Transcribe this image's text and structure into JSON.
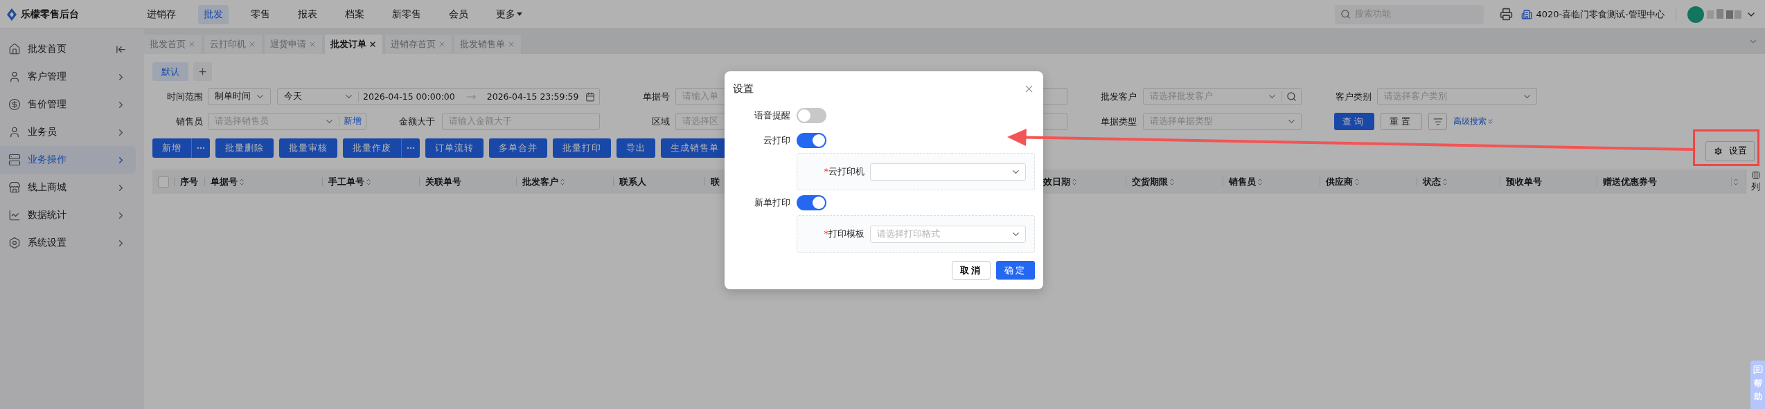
{
  "app": {
    "title": "乐檬零售后台"
  },
  "top_nav": [
    {
      "label": "进销存",
      "selected": false,
      "dropdown": false
    },
    {
      "label": "批发",
      "selected": true,
      "dropdown": false
    },
    {
      "label": "零售",
      "selected": false,
      "dropdown": false
    },
    {
      "label": "报表",
      "selected": false,
      "dropdown": false
    },
    {
      "label": "档案",
      "selected": false,
      "dropdown": false
    },
    {
      "label": "新零售",
      "selected": false,
      "dropdown": false
    },
    {
      "label": "会员",
      "selected": false,
      "dropdown": false
    },
    {
      "label": "更多",
      "selected": false,
      "dropdown": true
    }
  ],
  "header": {
    "search_placeholder": "搜索功能",
    "org": "4020-喜临门零食测试-管理中心"
  },
  "sidebar": [
    {
      "label": "批发首页",
      "selected": false
    },
    {
      "label": "客户管理",
      "selected": false
    },
    {
      "label": "售价管理",
      "selected": false
    },
    {
      "label": "业务员",
      "selected": false
    },
    {
      "label": "业务操作",
      "selected": true
    },
    {
      "label": "线上商城",
      "selected": false
    },
    {
      "label": "数据统计",
      "selected": false
    },
    {
      "label": "系统设置",
      "selected": false
    }
  ],
  "tabs": [
    {
      "label": "批发首页",
      "selected": false
    },
    {
      "label": "云打印机",
      "selected": false
    },
    {
      "label": "退货申请",
      "selected": false
    },
    {
      "label": "批发订单",
      "selected": true
    },
    {
      "label": "进销存首页",
      "selected": false
    },
    {
      "label": "批发销售单",
      "selected": false
    }
  ],
  "views": [
    {
      "label": "默认",
      "selected": true
    }
  ],
  "filters": {
    "time_range": {
      "label": "时间范围",
      "basis": "制单时间",
      "preset": "今天",
      "start": "2026-04-15 00:00:00",
      "end": "2026-04-15 23:59:59"
    },
    "doc_no": {
      "label": "单据号",
      "placeholder": "请输入单"
    },
    "customer": {
      "label": "批发客户",
      "placeholder": "请选择批发客户"
    },
    "customer_type": {
      "label": "客户类别",
      "placeholder": "请选择客户类别"
    },
    "salesperson": {
      "label": "销售员",
      "placeholder": "请选择销售员",
      "add_link": "新增"
    },
    "amount": {
      "label": "金额大于",
      "placeholder": "请输入金额大于"
    },
    "region": {
      "label": "区域",
      "placeholder": "请选择区"
    },
    "doc_type": {
      "label": "单据类型",
      "placeholder": "请选择单据类型"
    }
  },
  "search_actions": {
    "query": "查询",
    "reset": "重置",
    "advanced": "高级搜索"
  },
  "toolbar": [
    {
      "label": "新增",
      "more": true
    },
    {
      "label": "批量删除",
      "more": false
    },
    {
      "label": "批量审核",
      "more": false
    },
    {
      "label": "批量作废",
      "more": true
    },
    {
      "label": "订单流转",
      "more": false
    },
    {
      "label": "多单合并",
      "more": false
    },
    {
      "label": "批量打印",
      "more": false
    },
    {
      "label": "导出",
      "more": false
    },
    {
      "label": "生成销售单",
      "more": false
    }
  ],
  "settings_button": "设置",
  "table": {
    "select_all": {
      "checked": false
    },
    "columns": [
      {
        "label": "序号",
        "sortable": false
      },
      {
        "label": "单据号",
        "sortable": true
      },
      {
        "label": "手工单号",
        "sortable": true
      },
      {
        "label": "关联单号",
        "sortable": false
      },
      {
        "label": "批发客户",
        "sortable": true
      },
      {
        "label": "联系人",
        "sortable": false
      },
      {
        "label": "联",
        "sortable": false
      },
      {
        "label": "效日期",
        "sortable": true
      },
      {
        "label": "交货期限",
        "sortable": true
      },
      {
        "label": "销售员",
        "sortable": true
      },
      {
        "label": "供应商",
        "sortable": true
      },
      {
        "label": "状态",
        "sortable": true
      },
      {
        "label": "预收单号",
        "sortable": false
      },
      {
        "label": "赠送优惠券号",
        "sortable": false
      },
      {
        "sortable": true
      }
    ]
  },
  "column_settings": "列",
  "help": "帮助",
  "dialog": {
    "title": "设置",
    "rows": [
      {
        "label": "语音提醒",
        "on": false
      },
      {
        "label": "云打印",
        "on": true,
        "field": {
          "label": "云打印机",
          "marker": "*"
        }
      },
      {
        "label": "新单打印",
        "on": true,
        "field": {
          "label": "打印模板",
          "marker": "*",
          "placeholder": "请选择打印格式"
        }
      }
    ],
    "cancel": "取消",
    "ok": "确定"
  }
}
